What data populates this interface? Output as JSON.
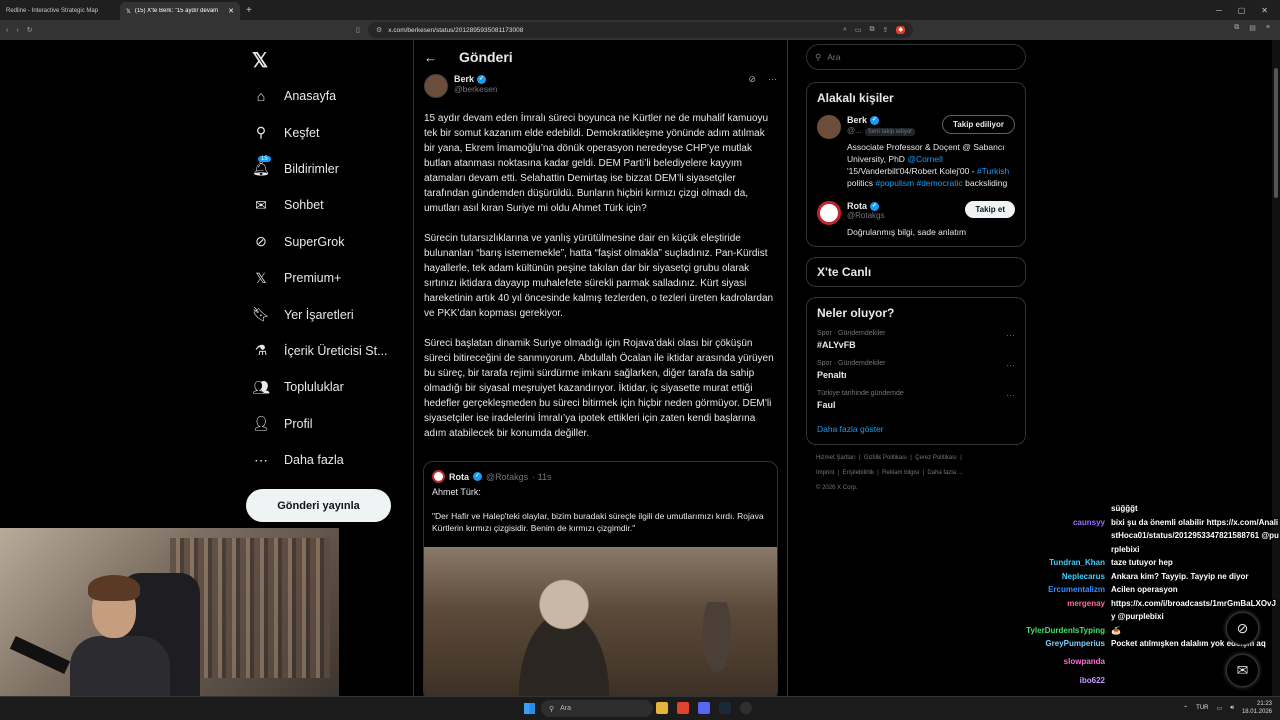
{
  "browser": {
    "tabs": [
      {
        "label": "Redline - Interactive Strategic Map",
        "active": false
      },
      {
        "label": "(15) X'te Berk: \"15 aydır devam e…",
        "active": true
      }
    ],
    "url": "x.com/berkesen/status/2012895935081173008"
  },
  "nav": {
    "items": [
      {
        "icon": "home-icon",
        "label": "Anasayfa"
      },
      {
        "icon": "search-icon",
        "label": "Keşfet"
      },
      {
        "icon": "bell-icon",
        "label": "Bildirimler",
        "badge": "15"
      },
      {
        "icon": "mail-icon",
        "label": "Sohbet"
      },
      {
        "icon": "grok-icon",
        "label": "SuperGrok"
      },
      {
        "icon": "x-icon",
        "label": "Premium+"
      },
      {
        "icon": "bookmark-icon",
        "label": "Yer İşaretleri"
      },
      {
        "icon": "flask-icon",
        "label": "İçerik Üreticisi St..."
      },
      {
        "icon": "people-icon",
        "label": "Topluluklar"
      },
      {
        "icon": "person-icon",
        "label": "Profil"
      },
      {
        "icon": "more-circle-icon",
        "label": "Daha fazla"
      }
    ],
    "post_button": "Gönderi yayınla"
  },
  "post": {
    "header": "Gönderi",
    "author_name": "Berk",
    "author_handle": "@berkesen",
    "paragraphs": [
      "15 aydır devam eden İmralı süreci boyunca ne Kürtler ne de muhalif kamuoyu tek bir somut kazanım elde edebildi. Demokratikleşme yönünde adım atılmak bir yana, Ekrem İmamoğlu’na dönük operasyon neredeyse CHP’ye mutlak butlan atanması noktasına kadar geldi. DEM Parti’li belediyelere kayyım atamaları devam etti. Selahattin Demirtaş ise bizzat DEM’li siyasetçiler tarafından gündemden düşürüldü. Bunların hiçbiri kırmızı çizgi olmadı da, umutları asıl kıran Suriye mi oldu Ahmet Türk için?",
      "Sürecin tutarsızlıklarına ve yanlış yürütülmesine dair en küçük eleştiride bulunanları “barış istememekle”, hatta “faşist olmakla” suçladınız. Pan-Kürdist hayallerle, tek adam kültünün peşine takılan dar bir siyasetçi grubu olarak sırtınızı iktidara dayayıp muhalefete sürekli parmak salladınız. Kürt siyasi hareketinin artık 40 yıl öncesinde kalmış tezlerden, o tezleri üreten kadrolardan ve PKK’dan kopması gerekiyor.",
      "Süreci başlatan dinamik Suriye olmadığı için Rojava’daki olası bir çöküşün süreci bitireceğini de sanmıyorum. Abdullah Öcalan ile iktidar arasında yürüyen bu süreç, bir tarafa rejimi sürdürme imkanı sağlarken, diğer tarafa da sahip olmadığı bir siyasal meşruiyet kazandırıyor. İktidar, iç siyasette murat ettiği hedefler gerçekleşmeden bu süreci bitirmek için hiçbir neden görmüyor. DEM’li siyasetçiler ise iradelerini İmralı’ya ipotek ettikleri için zaten kendi başlarına adım atabilecek bir konumda değiller."
    ],
    "quote": {
      "name": "Rota",
      "handle": "@Rotakgs",
      "time": "· 11s",
      "subtitle": "Ahmet Türk:",
      "text": "\"Der Hafir ve Halep'teki olaylar, bizim buradaki süreçle ilgili de umutlarımızı kırdı. Rojava Kürtlerin kırmızı çizgisidir. Benim de kırmızı çizgimdir.\""
    }
  },
  "sidebar": {
    "search_placeholder": "Ara",
    "related_title": "Alakalı kişiler",
    "related": [
      {
        "name": "Berk",
        "handle": "@...",
        "follows_you": "Seni takip ediyor",
        "button": "Takip ediliyor",
        "bio_parts": [
          {
            "t": "Associate Professor & Doçent @ Sabancı University, PhD ",
            "hl": false
          },
          {
            "t": "@Cornell",
            "hl": true
          },
          {
            "t": " '15/Vanderbilt'04/Robert Kolej'00 - ",
            "hl": false
          },
          {
            "t": "#Turkish",
            "hl": true
          },
          {
            "t": " politics ",
            "hl": false
          },
          {
            "t": "#populism",
            "hl": true
          },
          {
            "t": " ",
            "hl": false
          },
          {
            "t": "#democratic",
            "hl": true
          },
          {
            "t": " backsliding",
            "hl": false
          }
        ]
      },
      {
        "name": "Rota",
        "handle": "@Rotakgs",
        "follows_you": "",
        "button": "Takip et",
        "bio_parts": [
          {
            "t": "Doğrulanmış bilgi, sade anlatım",
            "hl": false
          }
        ]
      }
    ],
    "live_title": "X'te Canlı",
    "trends_title": "Neler oluyor?",
    "trends": [
      {
        "category": "Spor · Gündemdekiler",
        "name": "#ALYvFB"
      },
      {
        "category": "Spor · Gündemdekiler",
        "name": "Penaltı"
      },
      {
        "category": "Türkiye tarihinde gündemde",
        "name": "Faul"
      }
    ],
    "show_more": "Daha fazla göster",
    "footer": [
      "Hizmet Şartları",
      "Gizlilik Politikası",
      "Çerez Politikası",
      "Imprint",
      "Erişilebilirlik",
      "Reklam bilgisi",
      "Daha fazla …",
      "© 2026 X Corp."
    ]
  },
  "chat": [
    {
      "user": "",
      "color": "#ffffff",
      "msg": "süğğğt"
    },
    {
      "user": "caunsyy",
      "color": "#9b6cff",
      "msg": "bixi şu da önemli olabilir https://x.com/AnalistHoca01/status/2012953347821588761 @purplebixi"
    },
    {
      "user": "Tundran_Khan",
      "color": "#3fd1ff",
      "msg": "taze tutuyor hep"
    },
    {
      "user": "Neplecarus",
      "color": "#3fd1ff",
      "msg": "Ankara kim? Tayyip. Tayyip ne diyor"
    },
    {
      "user": "Ercumentalizm",
      "color": "#3a8bff",
      "msg": "Acilen operasyon"
    },
    {
      "user": "mergenay",
      "color": "#ff6b9a",
      "msg": "https://x.com/i/broadcasts/1mrGmBaLXOvJy @purplebixi"
    },
    {
      "user": "TylerDurdenIsTyping",
      "color": "#45e06a",
      "msg": "🍝"
    },
    {
      "user": "GreyPumperius",
      "color": "#7fd0ff",
      "msg": "Pocket atılmışken dalalım yok edelşm aq"
    },
    {
      "user": "slowpanda",
      "color": "#ff6bd6",
      "msg": ""
    },
    {
      "user": "ibo622",
      "color": "#c49bff",
      "msg": ""
    }
  ],
  "taskbar": {
    "search": "Ara",
    "lang": "TUR",
    "time": "21:23",
    "date": "18.01.2026"
  },
  "colors": {
    "accent": "#1d9bf0",
    "bg": "#000000",
    "text": "#e7e9ea",
    "muted": "#71767b"
  }
}
